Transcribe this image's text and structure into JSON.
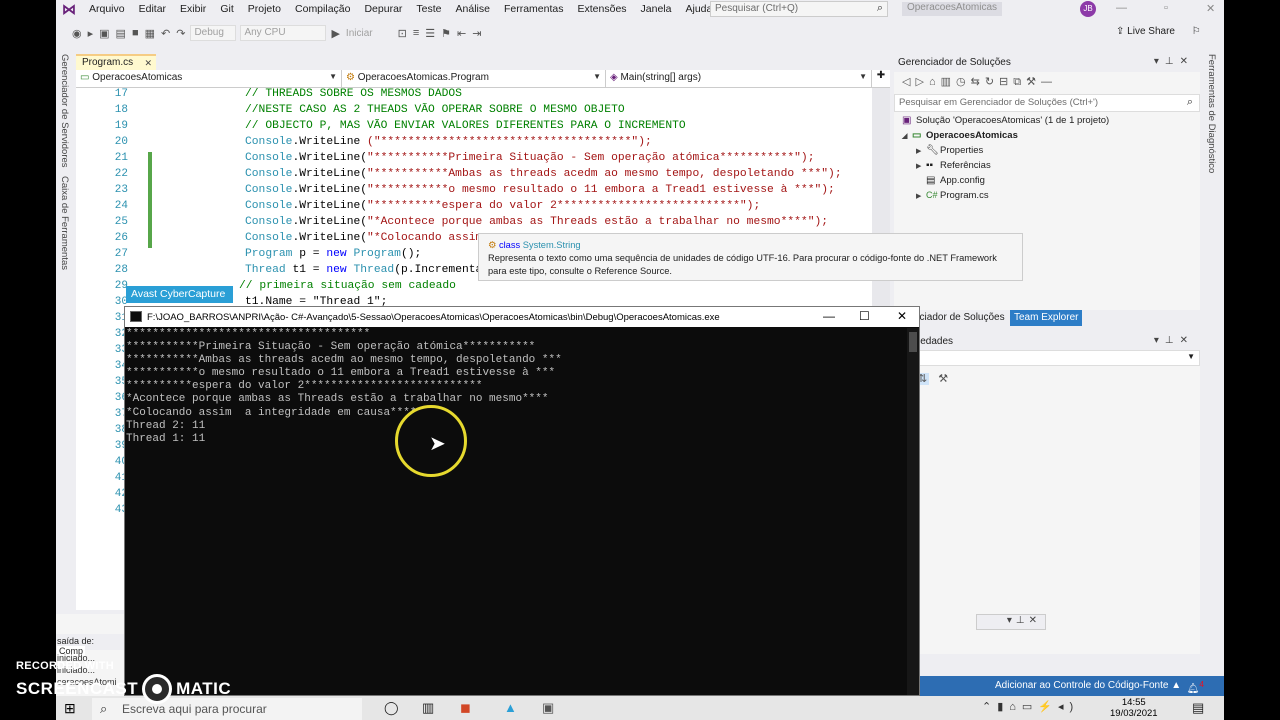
{
  "menu": {
    "items": [
      "Arquivo",
      "Editar",
      "Exibir",
      "Git",
      "Projeto",
      "Compilação",
      "Depurar",
      "Teste",
      "Análise",
      "Ferramentas",
      "Extensões",
      "Janela",
      "Ajuda"
    ],
    "search_placeholder": "Pesquisar (Ctrl+Q)",
    "solution_title": "OperacoesAtomicas",
    "avatar_initials": "JB"
  },
  "toolbar": {
    "config": "Debug",
    "platform": "Any CPU",
    "start_label": "Iniciar",
    "live_share": "Live Share"
  },
  "left_tabs": {
    "servers": "Gerenciador de Servidores",
    "toolbox": "Caixa de Ferramentas"
  },
  "right_tabs": {
    "diag": "Ferramentas de Diagnóstico"
  },
  "editor": {
    "tab_label": "Program.cs",
    "nav_project": "OperacoesAtomicas",
    "nav_class": "OperacoesAtomicas.Program",
    "nav_member": "Main(string[] args)",
    "line_numbers": [
      "17",
      "18",
      "19",
      "20",
      "21",
      "22",
      "23",
      "24",
      "25",
      "26",
      "27",
      "28",
      "29",
      "30",
      "31",
      "32",
      "33",
      "34",
      "35",
      "36",
      "37",
      "38",
      "39",
      "40",
      "41",
      "42",
      "43"
    ],
    "lines": {
      "l17": "// THREADS SOBRE OS MESMOS DADOS",
      "l18": "//NESTE CASO AS 2 THEADS VÃO OPERAR SOBRE O MESMO OBJETO",
      "l19": "// OBJECTO P, MAS VÃO ENVIAR VALORES DIFERENTES PARA O INCREMENTO",
      "console": "Console",
      "writeline": ".WriteLine ",
      "writeline2": ".WriteLine(",
      "s20": "(\"*************************************\");",
      "s21": "\"***********Primeira Situação - Sem operação atómica***********\");",
      "s22": "\"***********Ambas as threads acedm ao mesmo tempo, despoletando ***\");",
      "s23": "\"***********o mesmo resultado o 11 embora a Tread1 estivesse à ***\");",
      "s24": "\"**********espera do valor 2***************************\");",
      "s25": "\"*Acontece porque ambas as Threads estão a trabalhar no mesmo****\");",
      "s26": "\"*Colocando assim",
      "program_type": "Program",
      "l27_mid": " p = ",
      "kw_new": "new",
      "l27_end": "();",
      "thread_type": "Thread",
      "l28_mid": " t1 = ",
      "l28_end": "(p.Incrementa",
      "l29": "// primeira situação sem cadeado",
      "l30": "t1.Name = \"Thread 1\";"
    }
  },
  "tooltip": {
    "kind": "class",
    "name": "System.String",
    "description_line1": "Representa o texto como uma sequência de unidades de código UTF-16. Para procurar o código-fonte do .NET Framework",
    "description_line2": "para este tipo, consulte o Reference Source."
  },
  "avast_label": "Avast CyberCapture",
  "solution_explorer": {
    "title": "Gerenciador de Soluções",
    "search_placeholder": "Pesquisar em Gerenciador de Soluções (Ctrl+')",
    "solution": "Solução 'OperacoesAtomicas' (1 de 1 projeto)",
    "project": "OperacoesAtomicas",
    "items": [
      "Properties",
      "Referências",
      "App.config",
      "Program.cs"
    ],
    "tab_solution_truncated": "nciador de Soluções",
    "tab_team": "Team Explorer"
  },
  "properties": {
    "title_truncated": "iedades"
  },
  "output": {
    "tab_output": "saída de:",
    "tab_comp": "Comp",
    "lines": [
      "iniciado...",
      "iniciado...",
      "ceracoesAtomi"
    ]
  },
  "status_bar": {
    "source_control": "Adicionar ao Controle do Código-Fonte",
    "badge": "4"
  },
  "console": {
    "title": "F:\\JOAO_BARROS\\ANPRI\\Ação- C#-Avançado\\5-Sessao\\OperacoesAtomicas\\OperacoesAtomicas\\bin\\Debug\\OperacoesAtomicas.exe",
    "output": "*************************************\n***********Primeira Situação - Sem operação atómica***********\n***********Ambas as threads acedm ao mesmo tempo, despoletando ***\n***********o mesmo resultado o 11 embora a Tread1 estivesse à ***\n**********espera do valor 2***************************\n*Acontece porque ambas as Threads estão a trabalhar no mesmo****\n*Colocando assim  a integridade em causa****\nThread 2: 11\nThread 1: 11"
  },
  "taskbar": {
    "search_placeholder": "Escreva aqui para procurar",
    "time": "14:55",
    "date": "19/03/2021"
  },
  "watermark": {
    "line1": "RECORDED WITH",
    "brand_left": "SCREENCAST",
    "brand_right": "MATIC"
  },
  "colors": {
    "accent": "#2d6db3",
    "comment": "#008000",
    "string": "#a31515",
    "keyword": "#0000ff",
    "type": "#2b91af",
    "highlight_ring": "#e6d92e"
  }
}
